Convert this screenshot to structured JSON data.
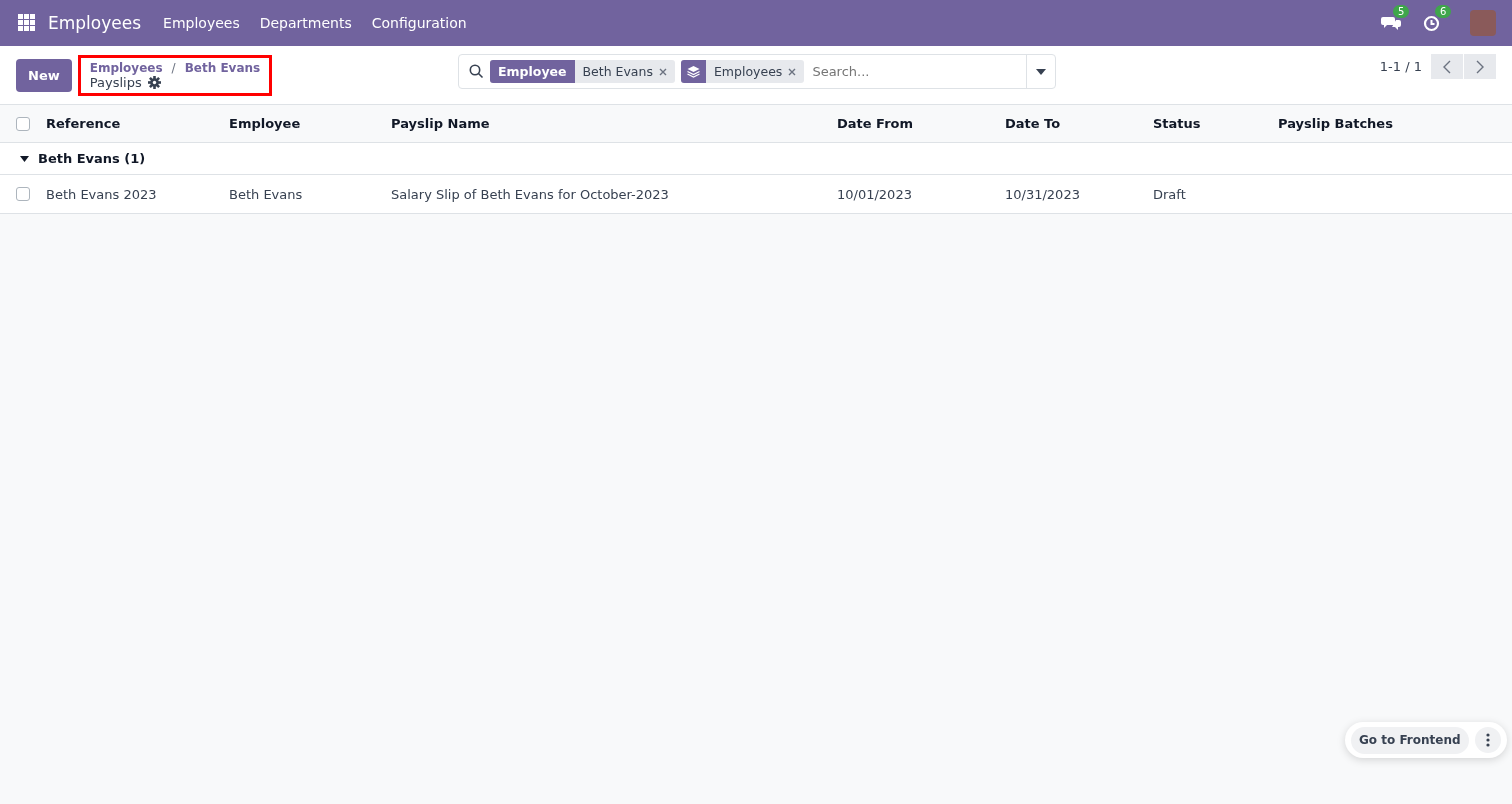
{
  "navbar": {
    "app_name": "Employees",
    "menu": [
      "Employees",
      "Departments",
      "Configuration"
    ],
    "messages_count": "5",
    "activities_count": "6"
  },
  "control_panel": {
    "new_button": "New",
    "breadcrumbs": [
      "Employees",
      "Beth Evans"
    ],
    "breadcrumb_separator": "/",
    "title": "Payslips",
    "highlighted": true,
    "search": {
      "facets": [
        {
          "kind": "field",
          "label": "Employee",
          "value": "Beth Evans"
        },
        {
          "kind": "groupby",
          "value": "Employees"
        }
      ],
      "placeholder": "Search..."
    },
    "pager": "1-1 / 1"
  },
  "table": {
    "all_checked": false,
    "columns": [
      "Reference",
      "Employee",
      "Payslip Name",
      "Date From",
      "Date To",
      "Status",
      "Payslip Batches"
    ],
    "groups": [
      {
        "label": "Beth Evans (1)",
        "expanded": true,
        "rows": [
          {
            "checked": false,
            "cells": [
              "Beth Evans 2023",
              "Beth Evans",
              "Salary Slip of Beth Evans for October-2023",
              "10/01/2023",
              "10/31/2023",
              "Draft",
              ""
            ]
          }
        ]
      }
    ]
  },
  "frontend_button": "Go to Frontend"
}
